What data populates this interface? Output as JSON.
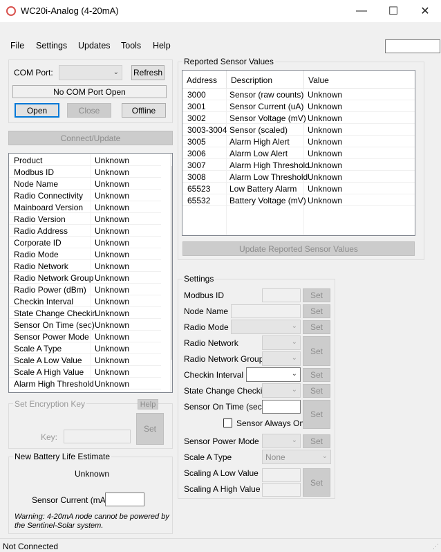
{
  "window": {
    "title": "WC20i-Analog (4-20mA)",
    "minimize": "—",
    "maximize": "☐",
    "close": "✕"
  },
  "menu": [
    "File",
    "Settings",
    "Updates",
    "Tools",
    "Help"
  ],
  "com": {
    "label": "COM Port:",
    "selected": "",
    "refresh": "Refresh",
    "status": "No COM Port Open",
    "open": "Open",
    "close": "Close",
    "offline": "Offline",
    "connect": "Connect/Update"
  },
  "device_info": [
    {
      "key": "Product",
      "value": "Unknown"
    },
    {
      "key": "Modbus ID",
      "value": "Unknown"
    },
    {
      "key": "Node Name",
      "value": "Unknown"
    },
    {
      "key": "Radio Connectivity",
      "value": "Unknown"
    },
    {
      "key": "Mainboard Version",
      "value": "Unknown"
    },
    {
      "key": "Radio Version",
      "value": "Unknown"
    },
    {
      "key": "Radio Address",
      "value": "Unknown"
    },
    {
      "key": "Corporate ID",
      "value": "Unknown"
    },
    {
      "key": "Radio Mode",
      "value": "Unknown"
    },
    {
      "key": "Radio Network",
      "value": "Unknown"
    },
    {
      "key": "Radio Network Group",
      "value": "Unknown"
    },
    {
      "key": "Radio Power (dBm)",
      "value": "Unknown"
    },
    {
      "key": "Checkin Interval",
      "value": "Unknown"
    },
    {
      "key": "State Change Checkin",
      "value": "Unknown"
    },
    {
      "key": "Sensor On Time (sec)",
      "value": "Unknown"
    },
    {
      "key": "Sensor Power Mode",
      "value": "Unknown"
    },
    {
      "key": "Scale A Type",
      "value": "Unknown"
    },
    {
      "key": "Scale A Low Value",
      "value": "Unknown"
    },
    {
      "key": "Scale A High Value",
      "value": "Unknown"
    },
    {
      "key": "Alarm High Threshold",
      "value": "Unknown"
    }
  ],
  "encryption": {
    "title": "Set Encryption Key",
    "help": "Help",
    "key_label": "Key:",
    "set": "Set"
  },
  "battery": {
    "title": "New Battery Life Estimate",
    "estimate": "Unknown",
    "current_label": "Sensor Current (mA):",
    "current_value": "",
    "warning": "Warning: 4-20mA node cannot be powered by the Sentinel-Solar system."
  },
  "reported": {
    "title": "Reported Sensor Values",
    "columns": [
      "Address",
      "Description",
      "Value"
    ],
    "rows": [
      {
        "address": "3000",
        "description": "Sensor (raw counts)",
        "value": "Unknown"
      },
      {
        "address": "3001",
        "description": "Sensor Current (uA)",
        "value": "Unknown"
      },
      {
        "address": "3002",
        "description": "Sensor Voltage (mV)",
        "value": "Unknown"
      },
      {
        "address": "3003-3004",
        "description": "Sensor (scaled)",
        "value": "Unknown"
      },
      {
        "address": "3005",
        "description": "Alarm High Alert",
        "value": "Unknown"
      },
      {
        "address": "3006",
        "description": "Alarm Low Alert",
        "value": "Unknown"
      },
      {
        "address": "3007",
        "description": "Alarm High Threshold",
        "value": "Unknown"
      },
      {
        "address": "3008",
        "description": "Alarm Low Threshold",
        "value": "Unknown"
      },
      {
        "address": "65523",
        "description": "Low Battery Alarm",
        "value": "Unknown"
      },
      {
        "address": "65532",
        "description": "Battery Voltage (mV)",
        "value": "Unknown"
      }
    ],
    "update_button": "Update Reported Sensor Values"
  },
  "settings": {
    "title": "Settings",
    "modbus_id": "Modbus ID",
    "node_name": "Node Name",
    "radio_mode": "Radio Mode",
    "radio_network": "Radio Network",
    "radio_network_group": "Radio Network Group",
    "checkin_interval": "Checkin Interval",
    "state_change_checkin": "State Change Checkin",
    "sensor_on_time": "Sensor On Time (sec)",
    "sensor_always_on": "Sensor Always On",
    "sensor_power_mode": "Sensor Power Mode",
    "scale_a_type": "Scale A Type",
    "scale_a_type_value": "None",
    "scaling_low": "Scaling A Low Value",
    "scaling_high": "Scaling A High Value",
    "set": "Set"
  },
  "status": "Not Connected"
}
